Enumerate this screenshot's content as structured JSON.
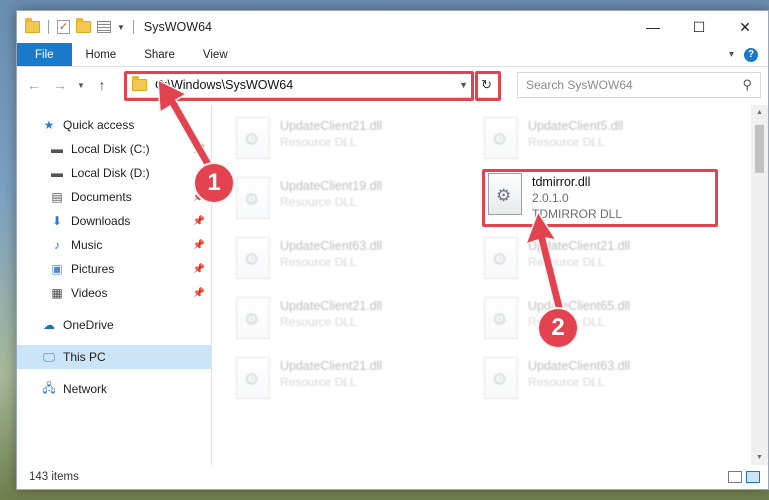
{
  "window": {
    "title": "SysWOW64",
    "controls": {
      "minimize": "—",
      "maximize": "☐",
      "close": "✕"
    }
  },
  "ribbon": {
    "tabs": [
      "File",
      "Home",
      "Share",
      "View"
    ]
  },
  "address": {
    "path": "C:\\Windows\\SysWOW64",
    "search_placeholder": "Search SysWOW64"
  },
  "nav": {
    "quick_access": "Quick access",
    "items": [
      {
        "label": "Local Disk (C:)",
        "icon": "drive-icon",
        "pinned": true
      },
      {
        "label": "Local Disk (D:)",
        "icon": "drive-icon",
        "pinned": false
      },
      {
        "label": "Documents",
        "icon": "documents-icon",
        "pinned": true
      },
      {
        "label": "Downloads",
        "icon": "downloads-icon",
        "pinned": true
      },
      {
        "label": "Music",
        "icon": "music-icon",
        "pinned": true
      },
      {
        "label": "Pictures",
        "icon": "pictures-icon",
        "pinned": true
      },
      {
        "label": "Videos",
        "icon": "videos-icon",
        "pinned": true
      }
    ],
    "onedrive": "OneDrive",
    "this_pc": "This PC",
    "network": "Network"
  },
  "files": [
    {
      "name": "UpdateClient21.dll",
      "type": "Resource DLL"
    },
    {
      "name": "UpdateClient5.dll",
      "type": "Resource DLL"
    },
    {
      "name": "UpdateClient19.dll",
      "type": "Resource DLL"
    },
    {
      "name": "tdmirror.dll",
      "version": "2.0.1.0",
      "type": "TDMIRROR DLL"
    },
    {
      "name": "UpdateClient63.dll",
      "type": "Resource DLL"
    },
    {
      "name": "UpdateClient21.dll",
      "type": "Resource DLL"
    },
    {
      "name": "UpdateClient21.dll",
      "type": "Resource DLL"
    },
    {
      "name": "UpdateClient65.dll",
      "type": "Resource DLL"
    },
    {
      "name": "UpdateClient21.dll",
      "type": "Resource DLL"
    },
    {
      "name": "UpdateClient63.dll",
      "type": "Resource DLL"
    }
  ],
  "status": {
    "items": "143 items"
  },
  "annotations": {
    "step1": "1",
    "step2": "2",
    "color": "#e2434f"
  }
}
